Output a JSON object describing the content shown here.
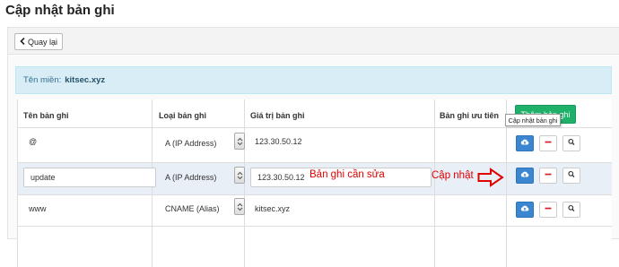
{
  "page": {
    "title": "Cập nhật bản ghi"
  },
  "toolbar": {
    "back_label": "Quay lại"
  },
  "domain": {
    "label": "Tên miền:",
    "value": "kitsec.xyz"
  },
  "table": {
    "headers": {
      "name": "Tên bản ghi",
      "type": "Loại bản ghi",
      "value": "Giá trị bản ghi",
      "priority": "Bản ghi ưu tiên"
    },
    "add_button": "Thêm bản ghi",
    "rows": [
      {
        "name": "@",
        "type": "A (IP Address)",
        "value": "123.30.50.12"
      },
      {
        "name": "update",
        "type": "A (IP Address)",
        "value": "123.30.50.12"
      },
      {
        "name": "www",
        "type": "CNAME (Alias)",
        "value": "kitsec.xyz"
      }
    ]
  },
  "tooltip": "Cập nhật bản ghi",
  "annotations": {
    "edit_note": "Bản ghi cần sửa",
    "update_note": "Cập nhật"
  },
  "colors": {
    "add_button": "#1fb06a",
    "update_button": "#3a86d0",
    "delete_icon": "#d9202a",
    "annotation": "#e00000",
    "info_bg": "#d9edf7"
  },
  "icons": {
    "back": "chevron-left-icon",
    "update": "cloud-upload-icon",
    "delete": "minus-icon",
    "view": "search-icon",
    "pointer": "arrow-right-icon"
  }
}
